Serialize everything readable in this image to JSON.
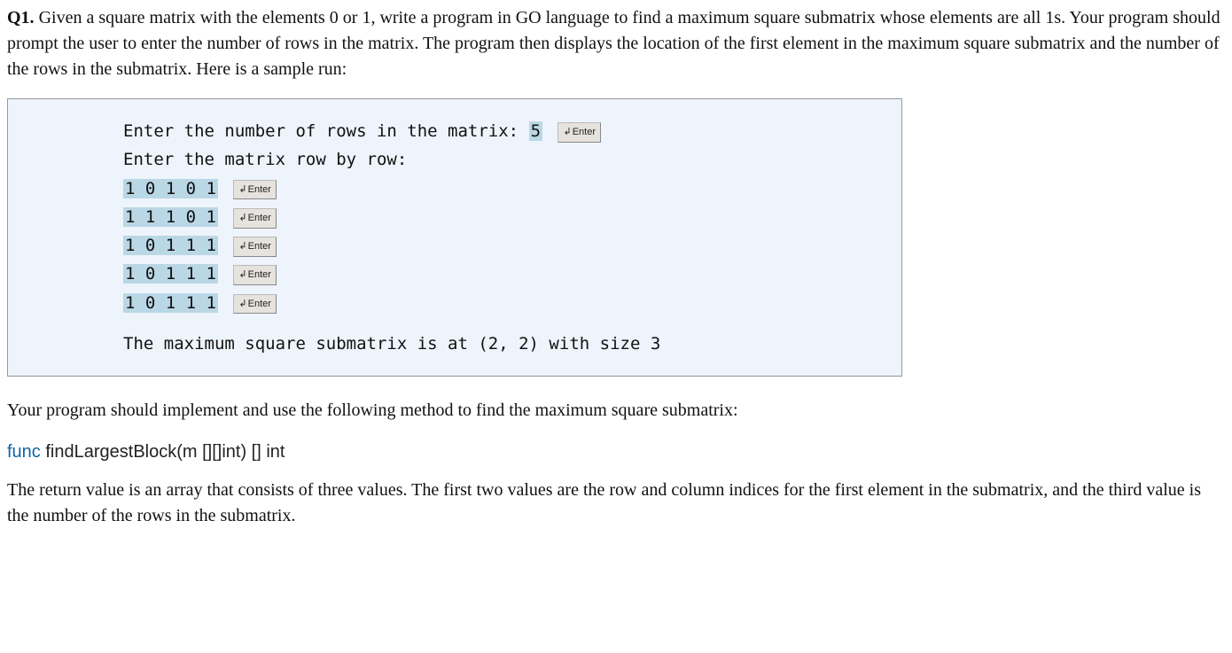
{
  "question": {
    "label": "Q1.",
    "text": "Given a square matrix with the elements 0 or 1, write a program in GO language to find a maximum square submatrix whose elements are all 1s. Your program should prompt the user to enter the number of rows in the matrix. The program then displays the location of the first element in the maximum square submatrix and the number of the rows in the submatrix. Here is a sample run:"
  },
  "sample": {
    "rows_prompt": "Enter the number of rows in the matrix: ",
    "rows_value": "5",
    "matrix_prompt": "Enter the matrix row by row:",
    "matrix": [
      "1 0 1 0 1",
      "1 1 1 0 1",
      "1 0 1 1 1",
      "1 0 1 1 1",
      "1 0 1 1 1"
    ],
    "enter_label": "Enter",
    "result": "The maximum square submatrix is at (2, 2) with size 3"
  },
  "after_para": "Your program should implement and use the following method to find the maximum square submatrix:",
  "signature": {
    "kw": "func",
    "rest": " findLargestBlock(m [][]int) [] int"
  },
  "return_para": "The return value is an array that consists of three values. The first two values are the row and column indices for the first element in the submatrix, and the third value is the number of the rows in the submatrix."
}
